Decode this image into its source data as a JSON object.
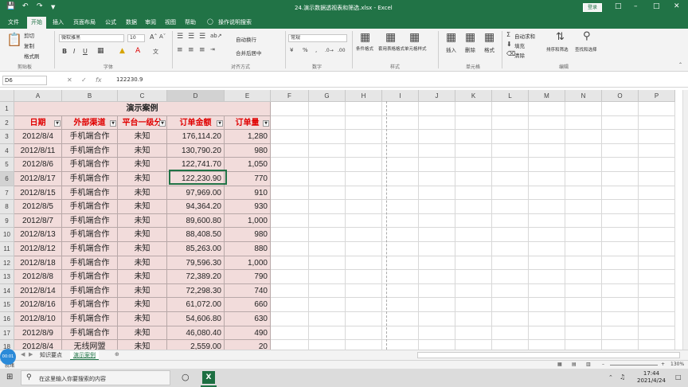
{
  "titlebar": {
    "title": "24.演示数据透视表和筛选.xlsx - Excel",
    "login": "登录"
  },
  "tabs": [
    "文件",
    "开始",
    "插入",
    "页面布局",
    "公式",
    "数据",
    "审阅",
    "视图",
    "帮助",
    "操作说明搜索"
  ],
  "ribbon": {
    "cut": "剪切",
    "copy": "复制",
    "format_painter": "格式刷",
    "clipboard": "剪贴板",
    "font_name": "微软雅黑",
    "font_size": "10",
    "font_group": "字体",
    "wrap": "自动换行",
    "merge": "合并后居中",
    "align_group": "对齐方式",
    "number_format": "常规",
    "number_group": "数字",
    "cond_format": "条件格式",
    "table_format": "套用表格格式",
    "cell_style": "单元格样式",
    "style_group": "样式",
    "insert": "插入",
    "delete": "删除",
    "format": "格式",
    "cells_group": "单元格",
    "autosum": "自动求和",
    "fill": "填充",
    "clear": "清除",
    "sort_filter": "排序和筛选",
    "find_select": "查找和选择",
    "edit_group": "编辑"
  },
  "formula_bar": {
    "name_box": "D6",
    "fx": "fx",
    "value": "122230.9"
  },
  "columns": [
    "A",
    "B",
    "C",
    "D",
    "E",
    "F",
    "G",
    "H",
    "I",
    "J",
    "K",
    "L",
    "M",
    "N",
    "O",
    "P"
  ],
  "table": {
    "title": "演示案例",
    "headers": [
      "日期",
      "外部渠道",
      "平台一级分",
      "订单金额",
      "订单量"
    ],
    "rows": [
      [
        "2012/8/4",
        "手机端合作",
        "未知",
        "176,114.20",
        "1,280"
      ],
      [
        "2012/8/11",
        "手机端合作",
        "未知",
        "130,790.20",
        "980"
      ],
      [
        "2012/8/6",
        "手机端合作",
        "未知",
        "122,741.70",
        "1,050"
      ],
      [
        "2012/8/17",
        "手机端合作",
        "未知",
        "122,230.90",
        "770"
      ],
      [
        "2012/8/15",
        "手机端合作",
        "未知",
        "97,969.00",
        "910"
      ],
      [
        "2012/8/5",
        "手机端合作",
        "未知",
        "94,364.20",
        "930"
      ],
      [
        "2012/8/7",
        "手机端合作",
        "未知",
        "89,600.80",
        "1,000"
      ],
      [
        "2012/8/13",
        "手机端合作",
        "未知",
        "88,408.50",
        "980"
      ],
      [
        "2012/8/12",
        "手机端合作",
        "未知",
        "85,263.00",
        "880"
      ],
      [
        "2012/8/18",
        "手机端合作",
        "未知",
        "79,596.30",
        "1,000"
      ],
      [
        "2012/8/8",
        "手机端合作",
        "未知",
        "72,389.20",
        "790"
      ],
      [
        "2012/8/14",
        "手机端合作",
        "未知",
        "72,298.30",
        "740"
      ],
      [
        "2012/8/16",
        "手机端合作",
        "未知",
        "61,072.00",
        "660"
      ],
      [
        "2012/8/10",
        "手机端合作",
        "未知",
        "54,606.80",
        "630"
      ],
      [
        "2012/8/9",
        "手机端合作",
        "未知",
        "46,080.40",
        "490"
      ],
      [
        "2012/8/4",
        "无线网盟",
        "未知",
        "2,559.00",
        "20"
      ]
    ]
  },
  "sheets": [
    "知识要点",
    "演示案例"
  ],
  "status": {
    "ready": "就绪",
    "zoom": "130%"
  },
  "taskbar": {
    "search_placeholder": "在这里输入你要搜索的内容",
    "time": "17:44",
    "date": "2021/4/24"
  },
  "bubble": "00:01"
}
